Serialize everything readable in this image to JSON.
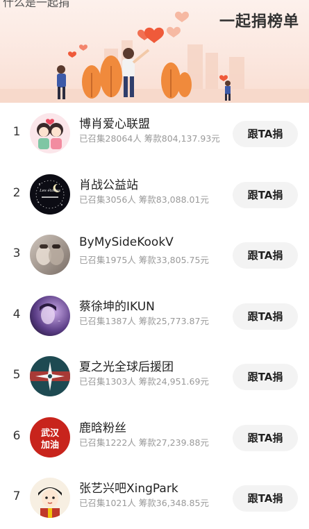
{
  "header": {
    "top_text": "什么是一起捐",
    "title": "一起捐榜单"
  },
  "list": {
    "button_label": "跟TA捐",
    "items": [
      {
        "rank": "1",
        "name": "博肖爱心联盟",
        "stats": "已召集28064人 筹款804,137.93元",
        "avatar_icon": "cartoon-couple-avatar"
      },
      {
        "rank": "2",
        "name": "肖战公益站",
        "stats": "已召集3056人 筹款83,088.01元",
        "avatar_icon": "night-moon-avatar",
        "avatar_text": "Les étoiles"
      },
      {
        "rank": "3",
        "name": "ByMySideKookV",
        "stats": "已召集1975人 筹款33,805.75元",
        "avatar_icon": "two-faces-avatar"
      },
      {
        "rank": "4",
        "name": "蔡徐坤的IKUN",
        "stats": "已召集1387人 筹款25,773.87元",
        "avatar_icon": "purple-portrait-avatar"
      },
      {
        "rank": "5",
        "name": "夏之光全球后援团",
        "stats": "已召集1303人 筹款24,951.69元",
        "avatar_icon": "star-compass-avatar"
      },
      {
        "rank": "6",
        "name": "鹿晗粉丝",
        "stats": "已召集1222人 筹款27,239.88元",
        "avatar_icon": "red-seal-avatar",
        "avatar_text": "武汉加油"
      },
      {
        "rank": "7",
        "name": "张艺兴吧XingPark",
        "stats": "已召集1021人 筹款36,348.85元",
        "avatar_icon": "cartoon-boy-avatar"
      }
    ]
  }
}
